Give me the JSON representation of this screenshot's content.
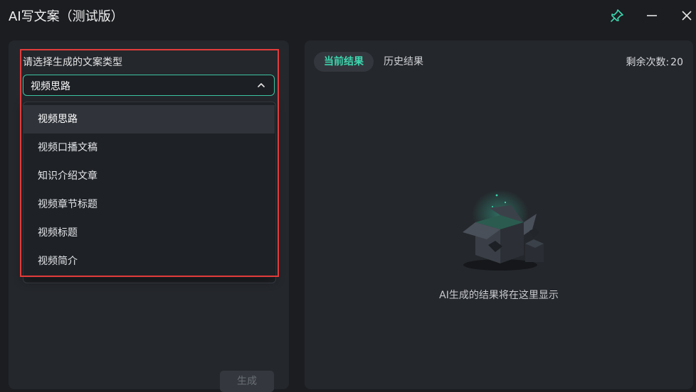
{
  "window": {
    "title": "AI写文案（测试版）",
    "pin_icon": "pin-icon",
    "minimize_icon": "minimize-icon",
    "close_icon": "close-icon"
  },
  "left": {
    "select_label": "请选择生成的文案类型",
    "selected_value": "视频思路",
    "options": [
      "视频思路",
      "视频口播文稿",
      "知识介绍文章",
      "视频章节标题",
      "视频标题",
      "视频简介"
    ],
    "generate_label": "生成"
  },
  "right": {
    "tabs": [
      "当前结果",
      "历史结果"
    ],
    "remaining_label": "剩余次数:",
    "remaining_count": "20",
    "empty_text": "AI生成的结果将在这里显示"
  },
  "colors": {
    "accent": "#3cc6a3",
    "highlight": "#e23b3b",
    "background": "#1b1d21",
    "panel": "#24272c"
  }
}
